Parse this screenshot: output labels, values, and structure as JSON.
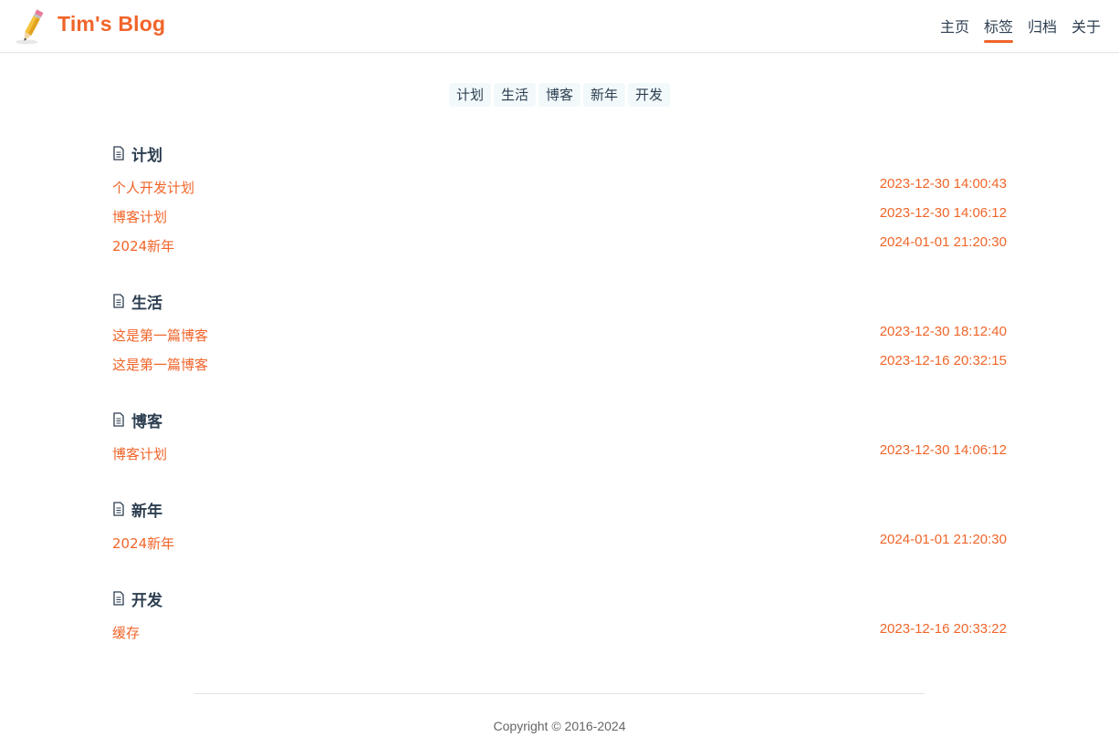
{
  "site": {
    "title": "Tim's Blog",
    "logo_icon": "pencil-icon"
  },
  "nav": {
    "items": [
      {
        "label": "主页",
        "active": false
      },
      {
        "label": "标签",
        "active": true
      },
      {
        "label": "归档",
        "active": false
      },
      {
        "label": "关于",
        "active": false
      }
    ]
  },
  "tag_cloud": [
    "计划",
    "生活",
    "博客",
    "新年",
    "开发"
  ],
  "sections": [
    {
      "tag": "计划",
      "posts": [
        {
          "title": "个人开发计划",
          "date": "2023-12-30 14:00:43"
        },
        {
          "title": "博客计划",
          "date": "2023-12-30 14:06:12"
        },
        {
          "title": "2024新年",
          "date": "2024-01-01 21:20:30"
        }
      ]
    },
    {
      "tag": "生活",
      "posts": [
        {
          "title": "这是第一篇博客",
          "date": "2023-12-30 18:12:40"
        },
        {
          "title": "这是第一篇博客",
          "date": "2023-12-16 20:32:15"
        }
      ]
    },
    {
      "tag": "博客",
      "posts": [
        {
          "title": "博客计划",
          "date": "2023-12-30 14:06:12"
        }
      ]
    },
    {
      "tag": "新年",
      "posts": [
        {
          "title": "2024新年",
          "date": "2024-01-01 21:20:30"
        }
      ]
    },
    {
      "tag": "开发",
      "posts": [
        {
          "title": "缓存",
          "date": "2023-12-16 20:33:22"
        }
      ]
    }
  ],
  "footer": {
    "copyright": "Copyright © 2016-2024"
  },
  "colors": {
    "accent": "#f0652a",
    "text": "#2c3e50",
    "tag_bg": "#f2f9fb"
  }
}
